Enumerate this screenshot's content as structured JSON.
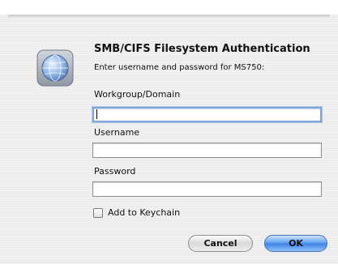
{
  "dialog": {
    "title": "SMB/CIFS Filesystem Authentication",
    "subtitle": "Enter username and password for MS750:",
    "icon": "network-globe-icon"
  },
  "fields": {
    "workgroup_label": "Workgroup/Domain",
    "workgroup_value": "",
    "username_label": "Username",
    "username_value": "",
    "password_label": "Password",
    "password_value": ""
  },
  "keychain": {
    "label": "Add to Keychain",
    "checked": false
  },
  "buttons": {
    "cancel_label": "Cancel",
    "ok_label": "OK"
  },
  "colors": {
    "focus_ring": "#7fa6dc",
    "default_button": "#5c9df0"
  }
}
